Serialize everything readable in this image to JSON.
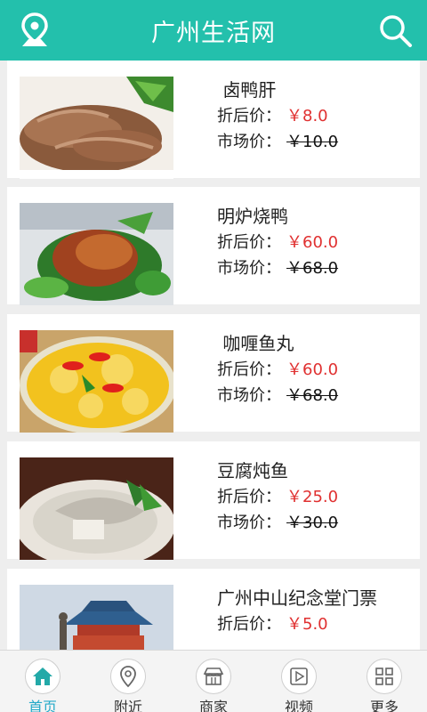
{
  "header": {
    "title": "广州生活网",
    "location_icon": "location-pin-icon",
    "search_icon": "search-icon"
  },
  "labels": {
    "discount": "折后价：",
    "market": "市场价："
  },
  "items": [
    {
      "name": "卤鸭肝",
      "discount_price": "￥8.0",
      "market_price": "￥10.0"
    },
    {
      "name": "明炉烧鸭",
      "discount_price": "￥60.0",
      "market_price": "￥68.0"
    },
    {
      "name": "咖喱鱼丸",
      "discount_price": "￥60.0",
      "market_price": "￥68.0"
    },
    {
      "name": "豆腐炖鱼",
      "discount_price": "￥25.0",
      "market_price": "￥30.0"
    },
    {
      "name": "广州中山纪念堂门票",
      "discount_price": "￥5.0",
      "market_price": ""
    }
  ],
  "tabbar": [
    {
      "label": "首页",
      "icon": "home-icon",
      "active": true
    },
    {
      "label": "附近",
      "icon": "map-pin-icon",
      "active": false
    },
    {
      "label": "商家",
      "icon": "store-icon",
      "active": false
    },
    {
      "label": "视频",
      "icon": "video-icon",
      "active": false
    },
    {
      "label": "更多",
      "icon": "grid-icon",
      "active": false
    }
  ],
  "colors": {
    "accent": "#23c0ac",
    "price_red": "#e03030",
    "tab_active": "#23a9c8"
  }
}
